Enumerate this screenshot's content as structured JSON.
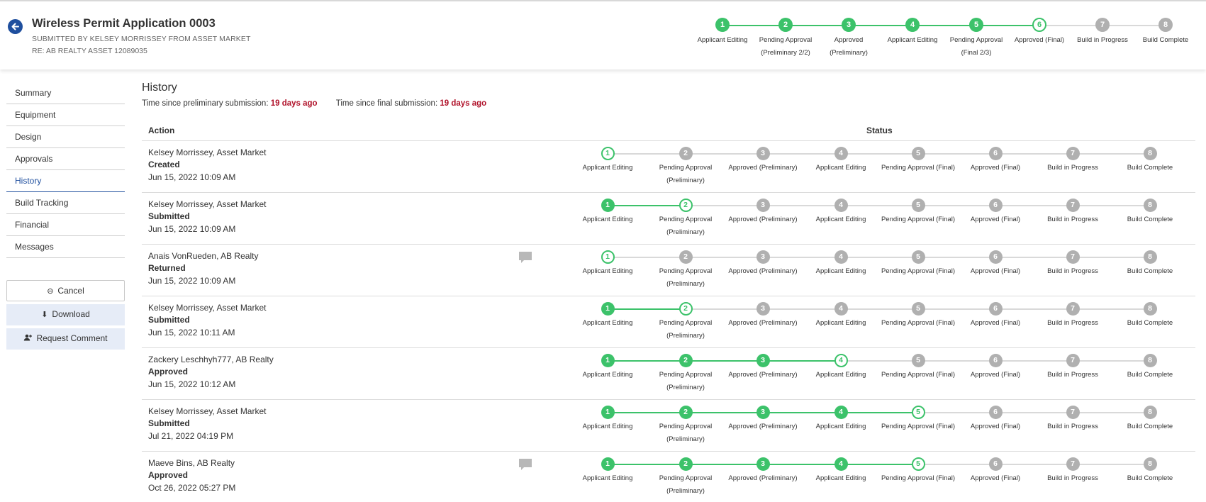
{
  "header": {
    "title": "Wireless Permit Application 0003",
    "submitted_by": "SUBMITTED BY KELSEY MORRISSEY FROM ASSET MARKET",
    "re": "RE: AB REALTY ASSET 12089035",
    "progress": {
      "current_step": 6,
      "steps": [
        {
          "num": "1",
          "label": "Applicant Editing",
          "label2": ""
        },
        {
          "num": "2",
          "label": "Pending Approval",
          "label2": "(Preliminary 2/2)"
        },
        {
          "num": "3",
          "label": "Approved",
          "label2": "(Preliminary)"
        },
        {
          "num": "4",
          "label": "Applicant Editing",
          "label2": ""
        },
        {
          "num": "5",
          "label": "Pending Approval",
          "label2": "(Final 2/3)"
        },
        {
          "num": "6",
          "label": "Approved (Final)",
          "label2": ""
        },
        {
          "num": "7",
          "label": "Build in Progress",
          "label2": ""
        },
        {
          "num": "8",
          "label": "Build Complete",
          "label2": ""
        }
      ]
    }
  },
  "sidebar": {
    "items": [
      {
        "label": "Summary",
        "active": false
      },
      {
        "label": "Equipment",
        "active": false
      },
      {
        "label": "Design",
        "active": false
      },
      {
        "label": "Approvals",
        "active": false
      },
      {
        "label": "History",
        "active": true
      },
      {
        "label": "Build Tracking",
        "active": false
      },
      {
        "label": "Financial",
        "active": false
      },
      {
        "label": "Messages",
        "active": false
      }
    ],
    "cancel_label": "Cancel",
    "download_label": "Download",
    "request_comment_label": "Request Comment"
  },
  "history": {
    "title": "History",
    "prelim_label": "Time since preliminary submission:",
    "prelim_value": "19 days ago",
    "final_label": "Time since final submission:",
    "final_value": "19 days ago",
    "col_action": "Action",
    "col_status": "Status",
    "status_steps": [
      {
        "num": "1",
        "label": "Applicant Editing",
        "label2": ""
      },
      {
        "num": "2",
        "label": "Pending Approval",
        "label2": "(Preliminary)"
      },
      {
        "num": "3",
        "label": "Approved (Preliminary)",
        "label2": ""
      },
      {
        "num": "4",
        "label": "Applicant Editing",
        "label2": ""
      },
      {
        "num": "5",
        "label": "Pending Approval (Final)",
        "label2": ""
      },
      {
        "num": "6",
        "label": "Approved (Final)",
        "label2": ""
      },
      {
        "num": "7",
        "label": "Build in Progress",
        "label2": ""
      },
      {
        "num": "8",
        "label": "Build Complete",
        "label2": ""
      }
    ],
    "rows": [
      {
        "who": "Kelsey Morrissey, Asset Market",
        "action": "Created",
        "when": "Jun 15, 2022 10:09 AM",
        "current_step": 1,
        "has_comment": false
      },
      {
        "who": "Kelsey Morrissey, Asset Market",
        "action": "Submitted",
        "when": "Jun 15, 2022 10:09 AM",
        "current_step": 2,
        "has_comment": false
      },
      {
        "who": "Anais VonRueden, AB Realty",
        "action": "Returned",
        "when": "Jun 15, 2022 10:09 AM",
        "current_step": 1,
        "has_comment": true
      },
      {
        "who": "Kelsey Morrissey, Asset Market",
        "action": "Submitted",
        "when": "Jun 15, 2022 10:11 AM",
        "current_step": 2,
        "has_comment": false
      },
      {
        "who": "Zackery Leschhyh777, AB Realty",
        "action": "Approved",
        "when": "Jun 15, 2022 10:12 AM",
        "current_step": 4,
        "has_comment": false
      },
      {
        "who": "Kelsey Morrissey, Asset Market",
        "action": "Submitted",
        "when": "Jul 21, 2022 04:19 PM",
        "current_step": 5,
        "has_comment": false
      },
      {
        "who": "Maeve Bins, AB Realty",
        "action": "Approved",
        "when": "Oct 26, 2022 05:27 PM",
        "current_step": 5,
        "has_comment": true
      }
    ]
  },
  "colors": {
    "done": "#3cc26a",
    "todo": "#b0b0b0",
    "line_todo": "#d9d9d9",
    "accent": "#1f4f9e",
    "highlight": "#b0122a"
  }
}
